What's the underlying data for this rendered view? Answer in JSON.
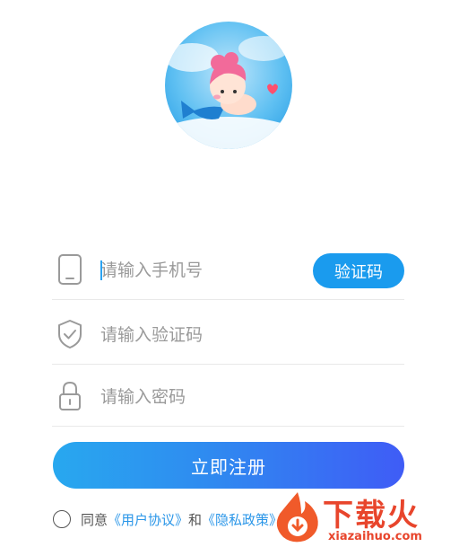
{
  "avatar": {
    "alt": "mermaid avatar"
  },
  "form": {
    "phone_placeholder": "请输入手机号",
    "code_button_label": "验证码",
    "code_placeholder": "请输入验证码",
    "password_placeholder": "请输入密码"
  },
  "register_label": "立即注册",
  "agreement": {
    "prefix": "同意",
    "user_agreement": "《用户协议》",
    "connector": "和",
    "privacy_policy": "《隐私政策》"
  },
  "watermark": {
    "title": "下载火",
    "url": "xiazaihuo.com"
  },
  "colors": {
    "accent": "#1a9bee",
    "gradient_end": "#3f5cf6",
    "watermark": "#e8452c"
  }
}
